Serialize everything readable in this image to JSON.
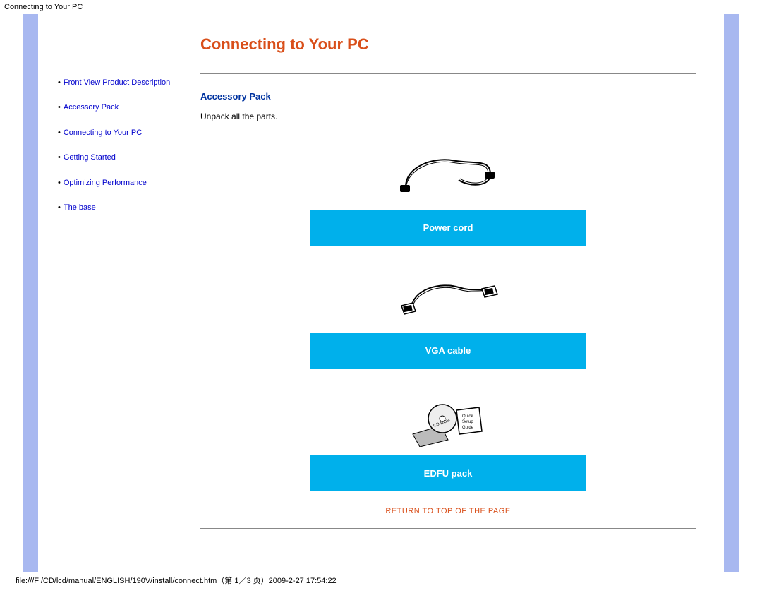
{
  "header": {
    "title": "Connecting to Your PC"
  },
  "sidebar": {
    "items": [
      {
        "label": "Front View Product Description"
      },
      {
        "label": "Accessory Pack"
      },
      {
        "label": "Connecting to Your PC"
      },
      {
        "label": "Getting Started"
      },
      {
        "label": "Optimizing Performance"
      },
      {
        "label": "The base"
      }
    ]
  },
  "content": {
    "page_title": "Connecting to Your PC",
    "section_title": "Accessory Pack",
    "intro_text": "Unpack all the parts.",
    "accessories": [
      {
        "label": "Power cord"
      },
      {
        "label": "VGA cable"
      },
      {
        "label": "EDFU pack"
      }
    ],
    "return_link": "RETURN TO TOP OF THE PAGE"
  },
  "footer": {
    "path": "file:///F|/CD/lcd/manual/ENGLISH/190V/install/connect.htm（第 1／3 页）2009-2-27 17:54:22"
  }
}
